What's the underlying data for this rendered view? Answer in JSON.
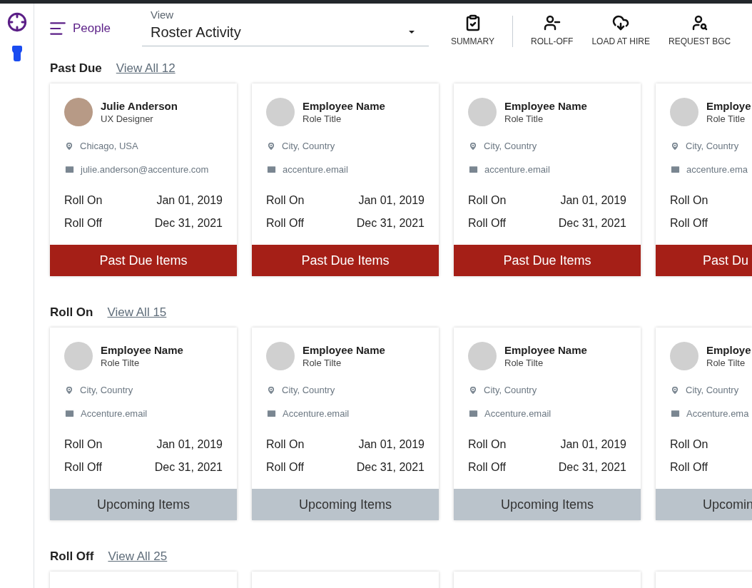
{
  "nav": {
    "title": "People"
  },
  "view_select": {
    "label": "View",
    "value": "Roster Activity"
  },
  "toolbar": [
    {
      "kind": "summary",
      "label": "SUMMARY"
    },
    {
      "kind": "roll_off",
      "label": "ROLL-OFF"
    },
    {
      "kind": "load",
      "label": "LOAD AT HIRE"
    },
    {
      "kind": "request",
      "label": "REQUEST BGC"
    }
  ],
  "sections": [
    {
      "title": "Past Due",
      "link": "View All 12",
      "cards": [
        {
          "kind": "full",
          "has_photo": true,
          "name": "Julie Anderson",
          "role": "UX Designer",
          "location": "Chicago, USA",
          "email": "julie.anderson@accenture.com",
          "roll_on_label": "Roll On",
          "roll_on": "Jan 01, 2019",
          "roll_off_label": "Roll Off",
          "roll_off": "Dec 31, 2021",
          "footer": {
            "label": "Past Due Items",
            "kind": "past_due"
          }
        },
        {
          "kind": "full",
          "has_photo": false,
          "name": "Employee Name",
          "role": "Role Title",
          "location": "City, Country",
          "email": "accenture.email",
          "roll_on_label": "Roll On",
          "roll_on": "Jan 01, 2019",
          "roll_off_label": "Roll Off",
          "roll_off": "Dec 31, 2021",
          "footer": {
            "label": "Past Due Items",
            "kind": "past_due"
          }
        },
        {
          "kind": "full",
          "has_photo": false,
          "name": "Employee Name",
          "role": "Role Title",
          "location": "City, Country",
          "email": "accenture.email",
          "roll_on_label": "Roll On",
          "roll_on": "Jan 01, 2019",
          "roll_off_label": "Roll Off",
          "roll_off": "Dec 31, 2021",
          "footer": {
            "label": "Past Due Items",
            "kind": "past_due"
          }
        },
        {
          "kind": "partial",
          "has_photo": false,
          "name": "Employe",
          "role": "Role Title",
          "location": "City, Country",
          "email": "accenture.ema",
          "roll_on_label": "Roll On",
          "roll_off_label": "Roll Off",
          "footer": {
            "label": "Past Du",
            "kind": "past_due"
          }
        }
      ]
    },
    {
      "title": "Roll On",
      "link": "View All 15",
      "cards": [
        {
          "kind": "full",
          "has_photo": false,
          "name": "Employee Name",
          "role": "Role Tilte",
          "location": "City, Country",
          "email": "Accenture.email",
          "roll_on_label": "Roll On",
          "roll_on": "Jan 01, 2019",
          "roll_off_label": "Roll Off",
          "roll_off": "Dec 31, 2021",
          "footer": {
            "label": "Upcoming Items",
            "kind": "upcoming"
          }
        },
        {
          "kind": "full",
          "has_photo": false,
          "name": "Employee Name",
          "role": "Role Tilte",
          "location": "City, Country",
          "email": "Accenture.email",
          "roll_on_label": "Roll On",
          "roll_on": "Jan 01, 2019",
          "roll_off_label": "Roll Off",
          "roll_off": "Dec 31, 2021",
          "footer": {
            "label": "Upcoming Items",
            "kind": "upcoming"
          }
        },
        {
          "kind": "full",
          "has_photo": false,
          "name": "Employee Name",
          "role": "Role Tilte",
          "location": "City, Country",
          "email": "Accenture.email",
          "roll_on_label": "Roll On",
          "roll_on": "Jan 01, 2019",
          "roll_off_label": "Roll Off",
          "roll_off": "Dec 31, 2021",
          "footer": {
            "label": "Upcoming Items",
            "kind": "upcoming"
          }
        },
        {
          "kind": "partial",
          "has_photo": false,
          "name": "Employe",
          "role": "Role Tilte",
          "location": "City, Country",
          "email": "Accenture.ema",
          "roll_on_label": "Roll On",
          "roll_off_label": "Roll Off",
          "footer": {
            "label": "Upcomin",
            "kind": "upcoming"
          }
        }
      ]
    },
    {
      "title": "Roll Off",
      "link": "View All 25",
      "cards": [
        {
          "kind": "blank"
        },
        {
          "kind": "blank"
        },
        {
          "kind": "blank"
        },
        {
          "kind": "blank"
        }
      ]
    }
  ]
}
